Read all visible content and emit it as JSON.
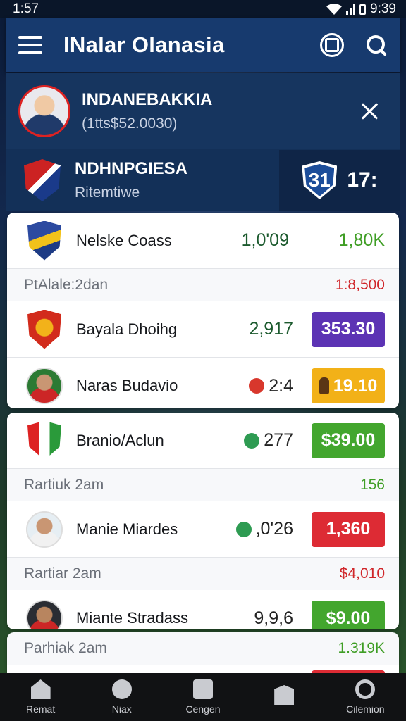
{
  "status": {
    "time_left": "1:57",
    "time_right": "9:39"
  },
  "appbar": {
    "title": "INalar Olanasia",
    "menu_icon": "hamburger-icon",
    "badge_icon": "badge-icon",
    "search_icon": "search-icon"
  },
  "match": {
    "name": "INDANEBAKKIA",
    "sub": "(1tts$52.0030)"
  },
  "team": {
    "name": "NDHNPGIESA",
    "sub": "Ritemtiwe",
    "score": "31",
    "time": "17:"
  },
  "card1": {
    "rows": [
      {
        "name": "Nelske Coass",
        "stat": "1,0'09",
        "value": "1,80K"
      }
    ],
    "sub": {
      "label": "PtAlale:2dan",
      "value": "1:8,500"
    },
    "rows2": [
      {
        "name": "Bayala Dhoihg",
        "stat": "2,917",
        "value": "353.30"
      },
      {
        "name": "Naras Budavio",
        "stat": "2:4",
        "value": "19.10"
      }
    ]
  },
  "card2": {
    "row1": {
      "name": "Branio/Aclun",
      "stat": "277",
      "value": "$39.00"
    },
    "sub1": {
      "label": "Rartiuk 2am",
      "value": "156"
    },
    "row2": {
      "name": "Manie Miardes",
      "stat": ",0'26",
      "value": "1,360"
    },
    "sub2": {
      "label": "Rartiar 2am",
      "value": "$4,010"
    },
    "row3": {
      "name": "Miante Stradass",
      "stat": "9,9,6",
      "value": "$9.00"
    }
  },
  "card3": {
    "sub": {
      "label": "Parhiak 2am",
      "value": "1.319K"
    }
  },
  "nav": [
    {
      "label": "Remat",
      "icon": "home-icon"
    },
    {
      "label": "Niax",
      "icon": "ball-icon"
    },
    {
      "label": "Cengen",
      "icon": "stack-icon"
    },
    {
      "label": "",
      "icon": "box-icon"
    },
    {
      "label": "Cilemion",
      "icon": "search-icon"
    }
  ],
  "colors": {
    "appbar": "#173a6e",
    "purple": "#5c33b4",
    "yellow": "#f2b118",
    "green": "#43a62e",
    "red": "#dd2b34"
  }
}
